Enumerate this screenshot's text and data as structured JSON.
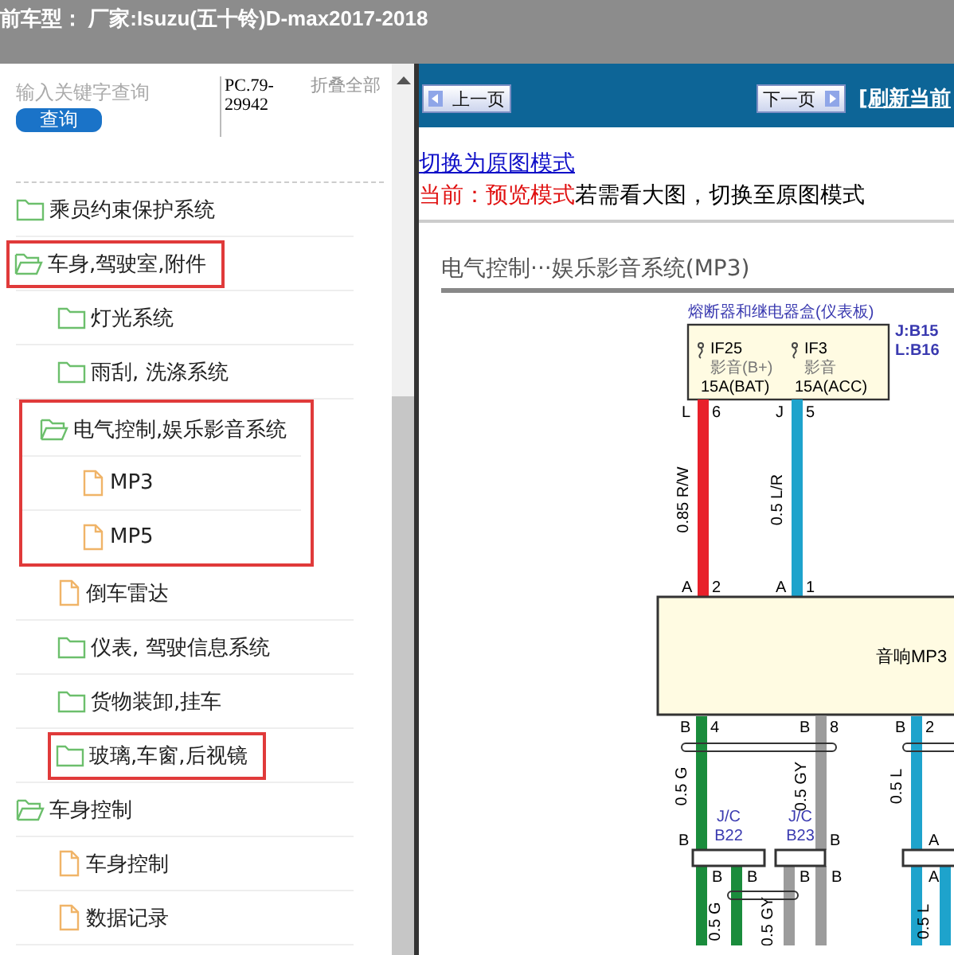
{
  "header": {
    "title": "前车型： 厂家:Isuzu(五十铃)D-max2017-2018"
  },
  "sidebar": {
    "search": {
      "placeholder": "输入关键字查询"
    },
    "search_button": "查询",
    "code": "PC.79-29942",
    "collapse_all": "折叠全部",
    "tree": [
      {
        "label": "乘员约束保护系统",
        "kind": "folder",
        "expanded": false,
        "highlighted": false
      },
      {
        "label": "车身,驾驶室,附件",
        "kind": "folder",
        "expanded": true,
        "highlighted": true,
        "children": [
          {
            "label": "灯光系统",
            "kind": "folder",
            "expanded": false,
            "highlighted": false
          },
          {
            "label": "雨刮, 洗涤系统",
            "kind": "folder",
            "expanded": false,
            "highlighted": false
          },
          {
            "label": "电气控制,娱乐影音系统",
            "kind": "folder",
            "expanded": true,
            "highlighted": true,
            "children": [
              {
                "label": "MP3",
                "kind": "file",
                "highlighted": true
              },
              {
                "label": "MP5",
                "kind": "file",
                "highlighted": true
              }
            ]
          },
          {
            "label": "倒车雷达",
            "kind": "file",
            "highlighted": false
          },
          {
            "label": "仪表, 驾驶信息系统",
            "kind": "folder",
            "expanded": false,
            "highlighted": false
          },
          {
            "label": "货物装卸,挂车",
            "kind": "folder",
            "expanded": false,
            "highlighted": false
          },
          {
            "label": "玻璃,车窗,后视镜",
            "kind": "folder",
            "expanded": false,
            "highlighted": true
          }
        ]
      },
      {
        "label": "车身控制",
        "kind": "folder",
        "expanded": true,
        "highlighted": false,
        "children": [
          {
            "label": "车身控制",
            "kind": "file",
            "highlighted": false
          },
          {
            "label": "数据记录",
            "kind": "file",
            "highlighted": false
          }
        ]
      }
    ]
  },
  "toolbar": {
    "prev_button": "上一页",
    "next_button": "下一页",
    "refresh_link": "[刷新当前"
  },
  "content": {
    "mode_link": "切换为原图模式",
    "mode_label": "当前：预览模式",
    "mode_hint": "若需看大图，切换至原图模式",
    "diagram": {
      "title": "电气控制···娱乐影音系统(MP3)",
      "fuse_box": {
        "label": "熔断器和继电器盒(仪表板)",
        "connector_codes": [
          "J:B15",
          "L:B16"
        ],
        "fuses": [
          {
            "name": "IF25",
            "function": "影音(B+)",
            "rating": "15A(BAT)"
          },
          {
            "name": "IF3",
            "function": "影音",
            "rating": "15A(ACC)"
          }
        ]
      },
      "upper_wires": [
        {
          "spec": "0.85 R/W",
          "color": "#e8202a",
          "top_pin": [
            "L",
            "6"
          ],
          "bottom_pin": [
            "A",
            "2"
          ]
        },
        {
          "spec": "0.5 L/R",
          "color": "#1ea3cc",
          "top_pin": [
            "J",
            "5"
          ],
          "bottom_pin": [
            "A",
            "1"
          ]
        }
      ],
      "unit": {
        "label": "音响MP3"
      },
      "lower_wires": [
        {
          "spec": "0.5 G",
          "color": "#1a8c3c",
          "pin": [
            "B",
            "4"
          ]
        },
        {
          "spec": "0.5 GY",
          "color": "#9c9c9c",
          "pin": [
            "B",
            "8"
          ]
        },
        {
          "spec": "0.5 L",
          "color": "#1ea3cc",
          "pin": [
            "B",
            "2"
          ]
        }
      ],
      "junctions": [
        {
          "label": "J/C",
          "code": "B22",
          "side_pin": "B",
          "bottom_pins": [
            "B",
            "B"
          ]
        },
        {
          "label": "J/C",
          "code": "B23",
          "side_pin": "B",
          "bottom_pins": [
            "B",
            "B"
          ]
        },
        {
          "side_pin": "A",
          "bottom_pins": [
            "A"
          ]
        }
      ],
      "branch_wires": [
        {
          "spec": "0.5 G",
          "color": "#1a8c3c"
        },
        {
          "spec": "0.5 GY",
          "color": "#9c9c9c"
        },
        {
          "spec": "0.5 L",
          "color": "#1ea3cc"
        }
      ]
    }
  }
}
